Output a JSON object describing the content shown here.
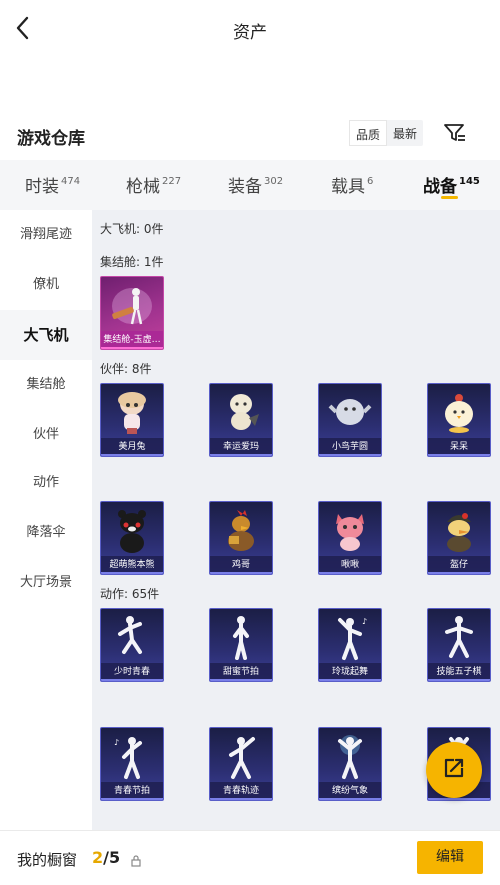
{
  "header": {
    "title": "资产"
  },
  "section": {
    "title": "游戏仓库",
    "sort_options": [
      "品质",
      "最新"
    ],
    "active_sort": "品质"
  },
  "tabs": [
    {
      "label": "时装",
      "count": "474"
    },
    {
      "label": "枪械",
      "count": "227"
    },
    {
      "label": "装备",
      "count": "302"
    },
    {
      "label": "载具",
      "count": "6"
    },
    {
      "label": "战备",
      "count": "145",
      "active": true
    }
  ],
  "sidebar": {
    "items": [
      {
        "label": "滑翔尾迹"
      },
      {
        "label": "僚机"
      },
      {
        "label": "大飞机",
        "active": true
      },
      {
        "label": "集结舱"
      },
      {
        "label": "伙伴"
      },
      {
        "label": "动作"
      },
      {
        "label": "降落伞"
      },
      {
        "label": "大厅场景"
      }
    ]
  },
  "content": {
    "groups": [
      {
        "title": "大飞机: 0件",
        "items": []
      },
      {
        "title": "集结舱: 1件",
        "items": [
          {
            "name": "集结舱-玉虚…",
            "icon": "pod-icon",
            "rarity": "pink"
          }
        ]
      },
      {
        "title": "伙伴: 8件",
        "items": [
          {
            "name": "美月兔",
            "icon": "rabbit-doll-icon"
          },
          {
            "name": "幸运爱玛",
            "icon": "sheep-icon"
          },
          {
            "name": "小鸟芋圆",
            "icon": "bird-icon"
          },
          {
            "name": "呆呆",
            "icon": "chick-icon"
          },
          {
            "name": "超萌熊本熊",
            "icon": "bear-icon"
          },
          {
            "name": "鸡哥",
            "icon": "rooster-icon"
          },
          {
            "name": "啾啾",
            "icon": "pink-creature-icon"
          },
          {
            "name": "盔仔",
            "icon": "helmet-duck-icon"
          }
        ]
      },
      {
        "title": "动作: 65件",
        "items": [
          {
            "name": "少时青春",
            "icon": "dance-pose-icon"
          },
          {
            "name": "甜蜜节拍",
            "icon": "dance-pose-icon"
          },
          {
            "name": "玲珑起舞",
            "icon": "dance-pose-icon"
          },
          {
            "name": "技能五子棋",
            "icon": "dance-pose-icon"
          },
          {
            "name": "青春节拍",
            "icon": "dance-pose-icon"
          },
          {
            "name": "青春轨迹",
            "icon": "dance-pose-icon"
          },
          {
            "name": "缤纷气象",
            "icon": "dance-pose-icon"
          },
          {
            "name": "",
            "icon": "dance-pose-icon"
          }
        ]
      }
    ]
  },
  "bottom": {
    "showcase_label": "我的橱窗",
    "current": "2",
    "total": "/5",
    "edit_label": "编辑"
  },
  "colors": {
    "accent": "#f6b400",
    "card_blue": "#2c2f73",
    "card_pink": "#a0338f"
  }
}
